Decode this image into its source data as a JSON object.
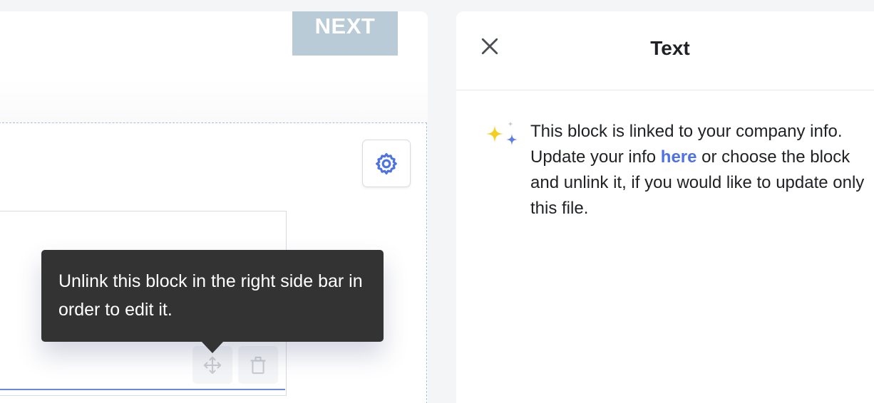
{
  "editor": {
    "next_label": "NEXT"
  },
  "tooltip": {
    "text": "Unlink this block in the right side bar in order to edit it."
  },
  "sidebar": {
    "title": "Text",
    "info_before": "This block is linked to your company info. Update your info ",
    "info_link": "here",
    "info_after": " or choose the block and unlink it, if you would like to update only this file."
  },
  "icons": {
    "close": "close-icon",
    "settings": "gear-icon",
    "move": "move-icon",
    "delete": "trash-icon",
    "sparkle": "sparkle-icon"
  },
  "colors": {
    "accent": "#4f72e3",
    "next_button": "#b9cbd6",
    "tooltip_bg": "#333333",
    "sparkle_yellow": "#f5cf1e"
  }
}
